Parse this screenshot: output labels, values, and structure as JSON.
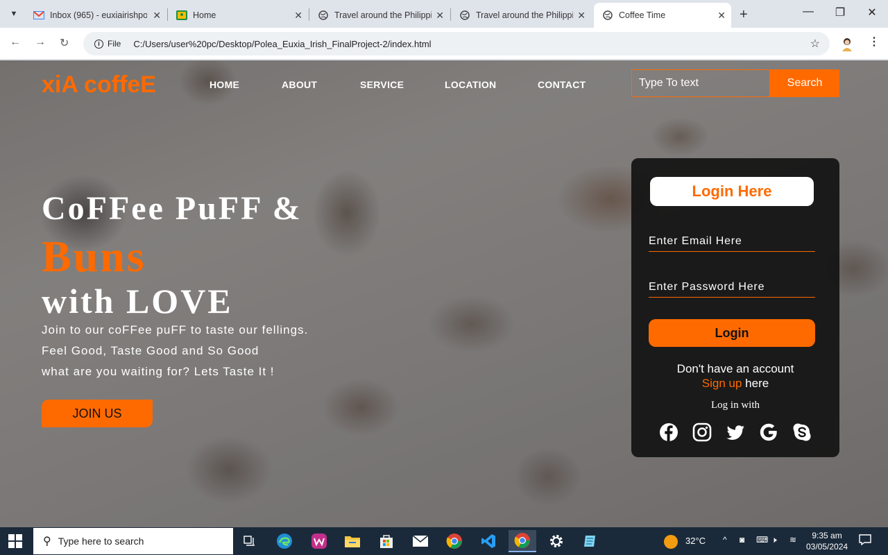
{
  "browser": {
    "tabs": [
      {
        "title": "Inbox (965) - euxiairishpolea",
        "icon": "gmail-icon"
      },
      {
        "title": "Home",
        "icon": "classroom-icon"
      },
      {
        "title": "Travel around the Philippines",
        "icon": "globe-icon"
      },
      {
        "title": "Travel around the Philippines",
        "icon": "globe-icon"
      },
      {
        "title": "Coffee Time",
        "icon": "globe-icon",
        "active": true
      }
    ],
    "site_label": "File",
    "url": "C:/Users/user%20pc/Desktop/Polea_Euxia_Irish_FinalProject-2/index.html"
  },
  "site": {
    "logo": "xiA coffeE",
    "nav": [
      "HOME",
      "ABOUT",
      "SERVICE",
      "LOCATION",
      "CONTACT"
    ],
    "search_placeholder": "Type To text",
    "search_button": "Search"
  },
  "hero": {
    "line1": "CoFFee PuFF &",
    "line2": "Buns",
    "line3": "with LOVE",
    "paragraph": [
      "Join to our coFFee puFF to taste our fellings.",
      "Feel Good, Taste Good and So Good",
      "what are you waiting for? Lets Taste It !"
    ],
    "cta": "JOIN US"
  },
  "login": {
    "title": "Login Here",
    "email_placeholder": "Enter Email Here",
    "password_placeholder": "Enter Password Here",
    "button": "Login",
    "no_account": "Don't have an account",
    "signup_link": "Sign up",
    "signup_suffix": " here",
    "log_in_with": "Log in with",
    "social": [
      "facebook-icon",
      "instagram-icon",
      "twitter-icon",
      "google-icon",
      "skype-icon"
    ]
  },
  "taskbar": {
    "search_placeholder": "Type here to search",
    "temperature": "32°C",
    "time": "9:35 am",
    "date": "03/05/2024"
  },
  "colors": {
    "accent": "#ff6a00",
    "card": "#121212",
    "taskbar": "#1b2a3a"
  }
}
